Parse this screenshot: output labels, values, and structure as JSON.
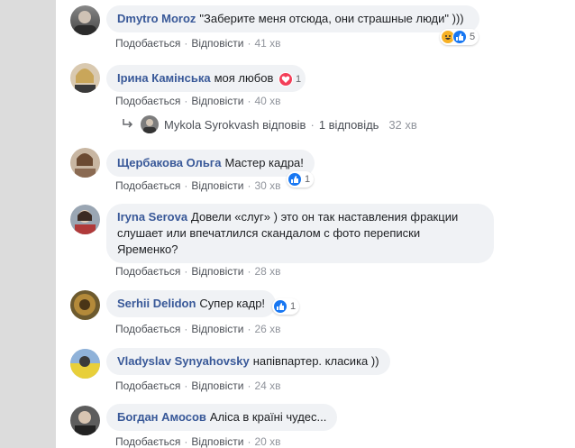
{
  "actions": {
    "like": "Подобається",
    "reply": "Відповісти"
  },
  "comments": [
    {
      "name": "Dmytro Moroz",
      "text": "\"Заберите меня отсюда, они страшные люди\" )))",
      "time": "41 хв",
      "reaction_count": "5"
    },
    {
      "name": "Ірина Камінська",
      "text": "моя любов",
      "time": "40 хв",
      "reaction_count": "1"
    },
    {
      "name": "Щербакова Ольга",
      "text": "Мастер кадра!",
      "time": "30 хв",
      "reaction_count": "1"
    },
    {
      "name": "Iryna Serova",
      "text_line1": "Довели «слуг» ) это он так наставления фракции",
      "text_line2": "слушает или впечатлился скандалом с фото переписки",
      "text_line3": "Яременко?",
      "time": "28 хв"
    },
    {
      "name": "Serhii Delidon",
      "text": "Супер кадр!",
      "time": "26 хв",
      "reaction_count": "1"
    },
    {
      "name": "Vladyslav Synyahovsky",
      "text": "напівпартер. класика ))",
      "time": "24 хв"
    },
    {
      "name": "Богдан Амосов",
      "text": "Аліса в країні чудес...",
      "time": "20 хв"
    }
  ],
  "reply_thread": {
    "name": "Mykola Syrokvash",
    "verb": "відповів",
    "count": "1 відповідь",
    "time": "32 хв"
  },
  "colors": {
    "name": "#385898",
    "bubble": "#f0f2f5",
    "like": "#1877f2",
    "love": "#f33e58",
    "haha": "#f7b125"
  }
}
